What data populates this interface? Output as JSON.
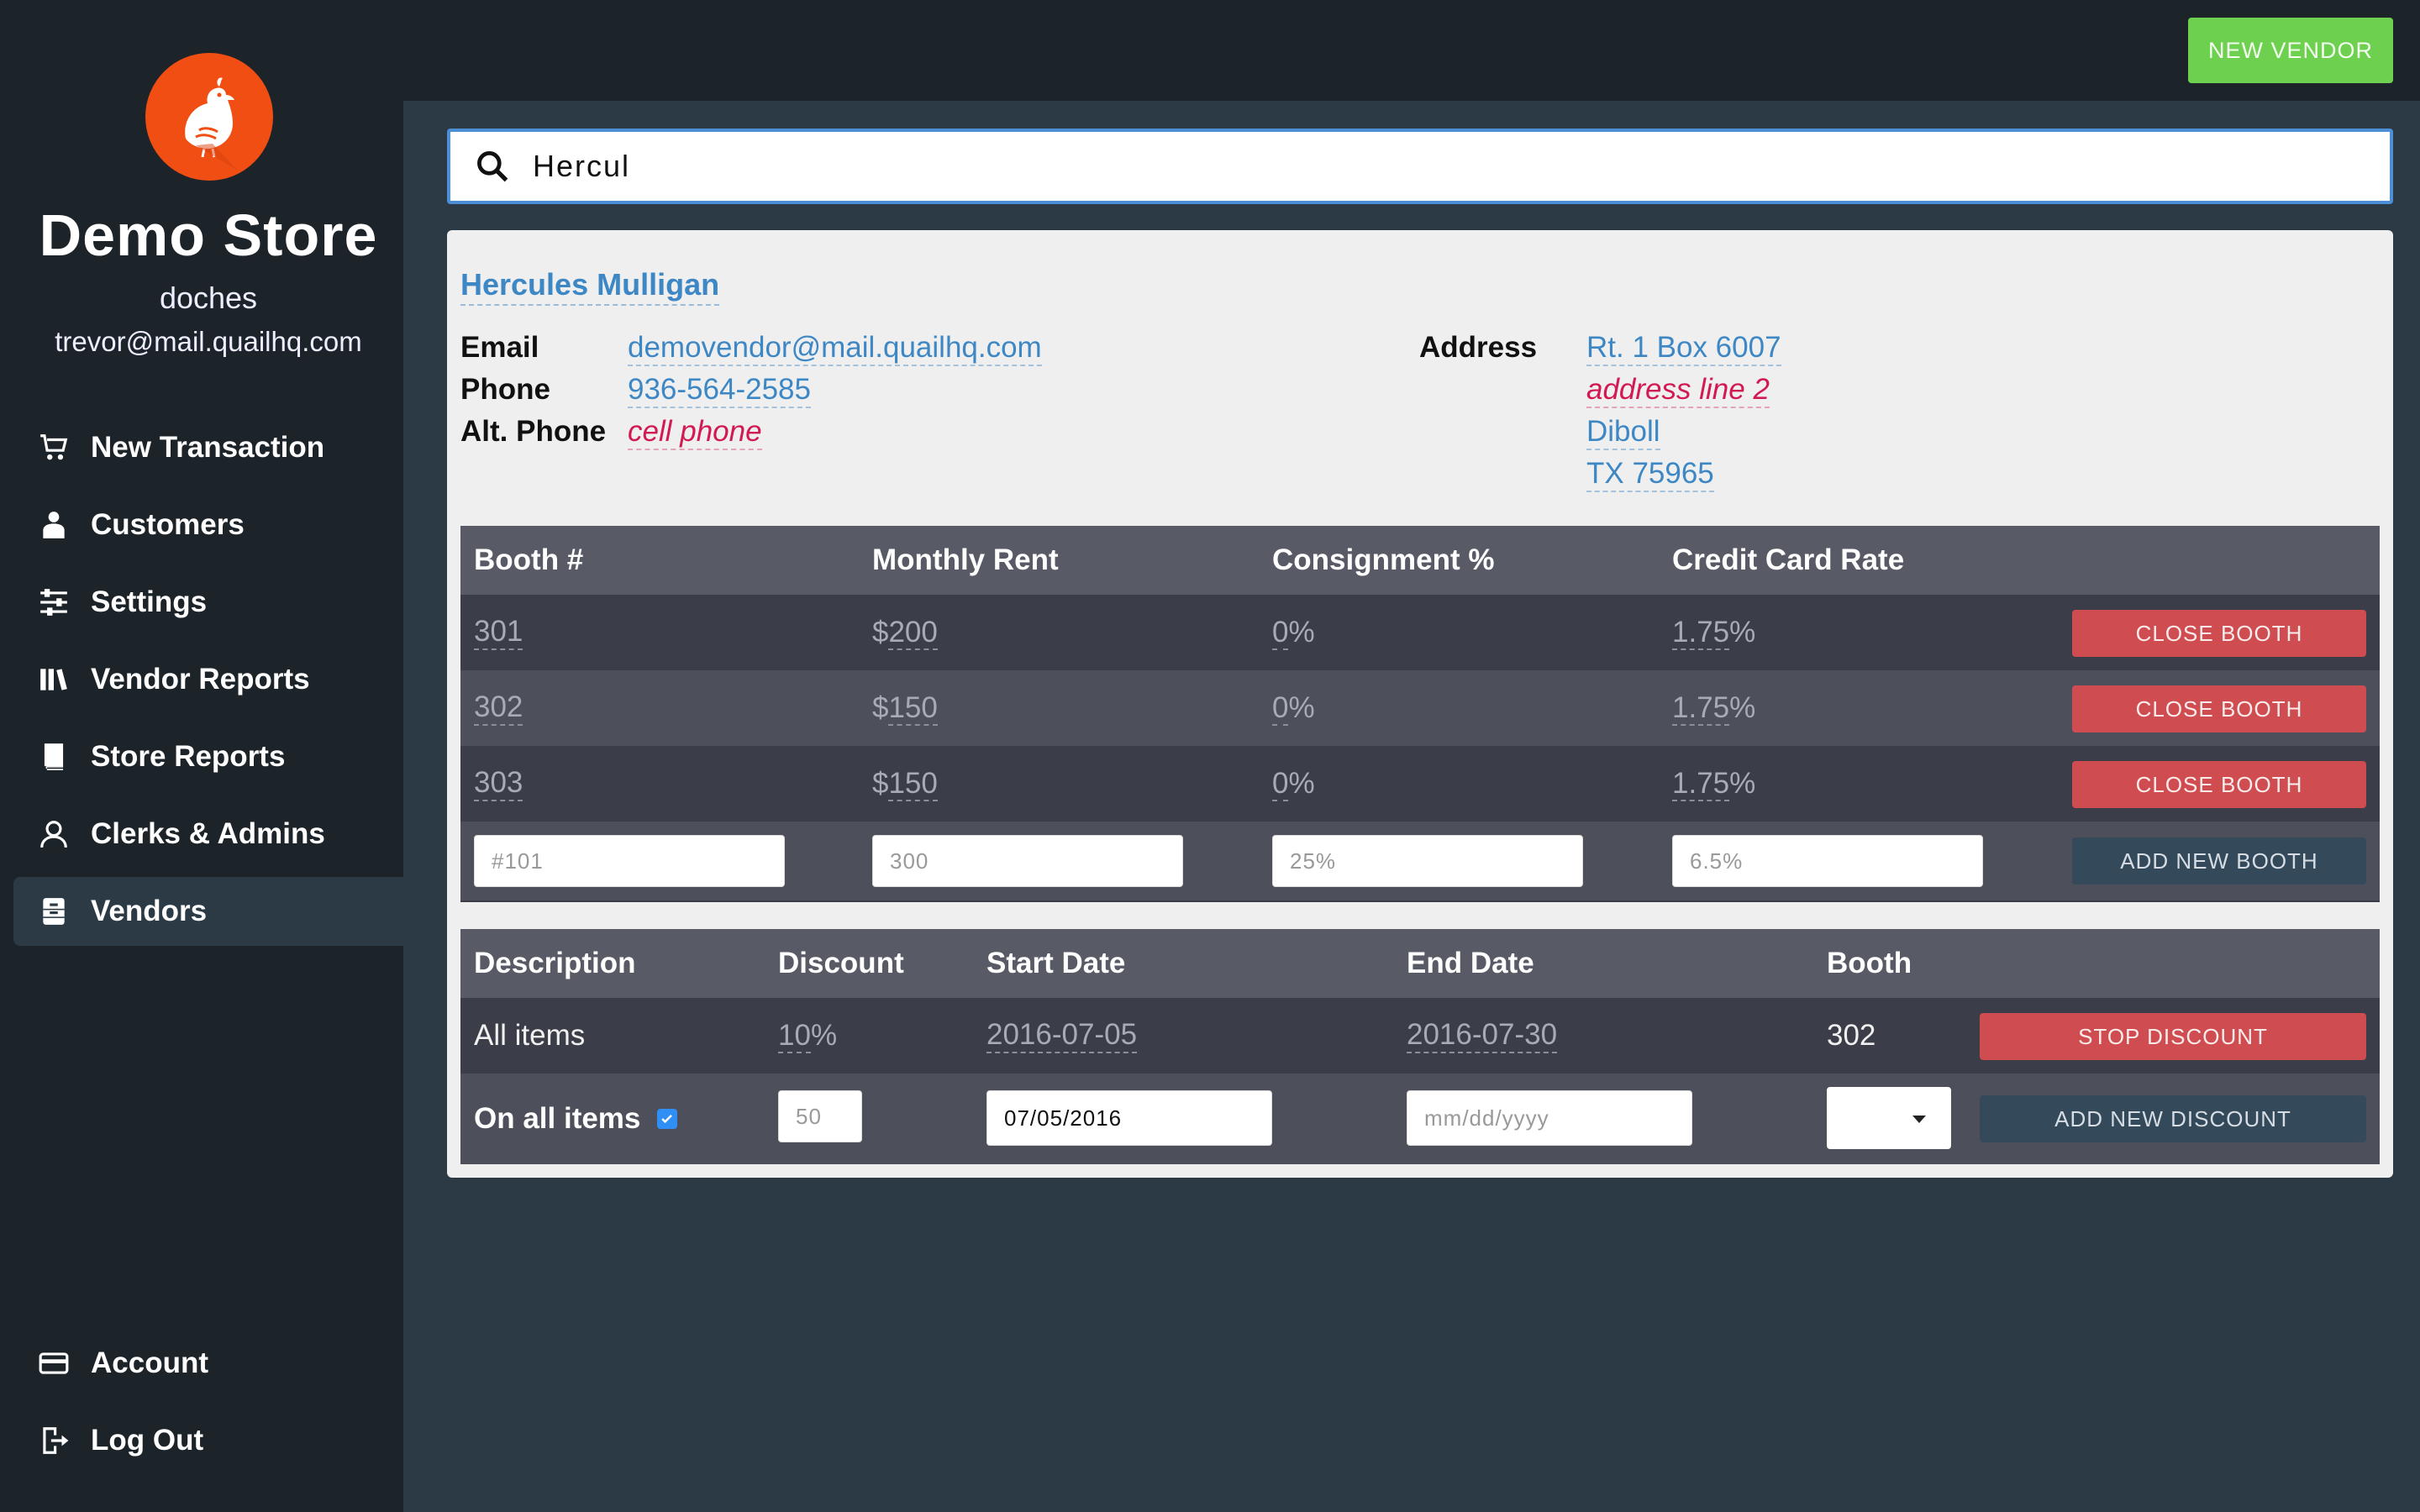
{
  "sidebar": {
    "store_name": "Demo Store",
    "store_sub": "doches",
    "store_email": "trevor@mail.quailhq.com",
    "nav": [
      {
        "label": "New Transaction",
        "icon": "cart-icon"
      },
      {
        "label": "Customers",
        "icon": "person-icon"
      },
      {
        "label": "Settings",
        "icon": "sliders-icon"
      },
      {
        "label": "Vendor Reports",
        "icon": "books-icon"
      },
      {
        "label": "Store Reports",
        "icon": "book-icon"
      },
      {
        "label": "Clerks & Admins",
        "icon": "user-outline-icon"
      },
      {
        "label": "Vendors",
        "icon": "cabinet-icon",
        "active": true
      }
    ],
    "bottom": [
      {
        "label": "Account",
        "icon": "credit-card-icon"
      },
      {
        "label": "Log Out",
        "icon": "logout-icon"
      }
    ]
  },
  "topbar": {
    "new_vendor_label": "NEW VENDOR",
    "accent": "#6dd04f"
  },
  "search": {
    "value": "Hercul"
  },
  "vendor": {
    "name": "Hercules Mulligan",
    "email_label": "Email",
    "email": "demovendor@mail.quailhq.com",
    "phone_label": "Phone",
    "phone": "936-564-2585",
    "alt_phone_label": "Alt. Phone",
    "alt_phone_placeholder": "cell phone",
    "address_label": "Address",
    "address_line1": "Rt. 1 Box 6007",
    "address_line2_placeholder": "address line 2",
    "city": "Diboll",
    "state_zip": "TX 75965"
  },
  "booths": {
    "headers": [
      "Booth #",
      "Monthly Rent",
      "Consignment %",
      "Credit Card Rate"
    ],
    "rows": [
      {
        "booth": "301",
        "rent_sym": "$",
        "rent": "200",
        "consign": "0",
        "consign_sym": "%",
        "cc": "1.75",
        "cc_sym": "%",
        "action": "CLOSE BOOTH"
      },
      {
        "booth": "302",
        "rent_sym": "$",
        "rent": "150",
        "consign": "0",
        "consign_sym": "%",
        "cc": "1.75",
        "cc_sym": "%",
        "action": "CLOSE BOOTH"
      },
      {
        "booth": "303",
        "rent_sym": "$",
        "rent": "150",
        "consign": "0",
        "consign_sym": "%",
        "cc": "1.75",
        "cc_sym": "%",
        "action": "CLOSE BOOTH"
      }
    ],
    "new_row": {
      "booth_placeholder": "#101",
      "rent_placeholder": "300",
      "consign_placeholder": "25%",
      "cc_placeholder": "6.5%",
      "add_label": "ADD NEW BOOTH"
    }
  },
  "discounts": {
    "headers": [
      "Description",
      "Discount",
      "Start Date",
      "End Date",
      "Booth"
    ],
    "rows": [
      {
        "description": "All items",
        "discount": "10",
        "discount_sym": "%",
        "start": "2016-07-05",
        "end": "2016-07-30",
        "booth": "302",
        "action": "STOP DISCOUNT"
      }
    ],
    "new_row": {
      "description": "On all items",
      "discount_placeholder": "50",
      "start_value": "07/05/2016",
      "end_placeholder": "mm/dd/yyyy",
      "add_label": "ADD NEW DISCOUNT"
    }
  }
}
